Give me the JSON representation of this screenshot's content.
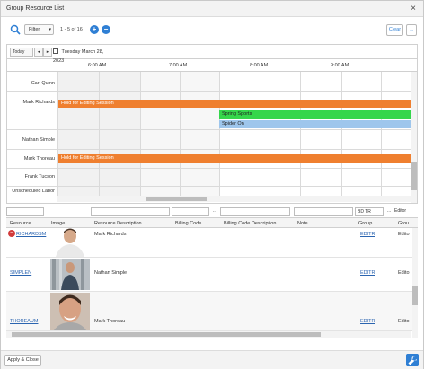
{
  "window": {
    "title": "Group Resource List",
    "close_glyph": "×"
  },
  "toolbar": {
    "filter_label": "Filter",
    "count_text": "1 - 5 of 16",
    "add_glyph": "+",
    "remove_glyph": "−",
    "clear_label": "Clear",
    "menu_glyph": "⌄",
    "accent_color": "#2f7fd4"
  },
  "scheduler": {
    "view": "Today",
    "prev_glyph": "◂",
    "next_glyph": "▸",
    "date": "Tuesday March 28, 2023",
    "times": [
      "6:00 AM",
      "7:00 AM",
      "8:00 AM",
      "9:00 AM"
    ],
    "resources": [
      "Carl Quinn",
      "Mark Richards",
      "Nathan Simple",
      "Mark Thoreau",
      "Frank Tucson",
      "Unscheduled Labor"
    ],
    "events": [
      {
        "label": "Hold for Editing Session",
        "color": "#ef7f2f"
      },
      {
        "label": "Spring Sports",
        "color": "#35d64b"
      },
      {
        "label": "Spider On",
        "color": "#9ec6ec"
      },
      {
        "label": "Hold for Editing Session",
        "color": "#ef7f2f"
      }
    ]
  },
  "filters": {
    "bd_tr": "BD TR",
    "ellipsis": "...",
    "editor": "Editor"
  },
  "list": {
    "columns": [
      "Resource",
      "Image",
      "Resource Description",
      "Billing Code",
      "Billing Code Description",
      "Note",
      "Group",
      "Grou"
    ],
    "rows": [
      {
        "resource": "RICHARDSM",
        "description": "Mark Richards",
        "group": "EDITR",
        "group2": "Edito"
      },
      {
        "resource": "SIMPLEN",
        "description": "Nathan Simple",
        "group": "EDITR",
        "group2": "Edito"
      },
      {
        "resource": "THOREAUM",
        "description": "Mark Thoreau",
        "group": "EDITR",
        "group2": "Edito"
      }
    ]
  },
  "footer": {
    "apply_label": "Apply & Close"
  }
}
